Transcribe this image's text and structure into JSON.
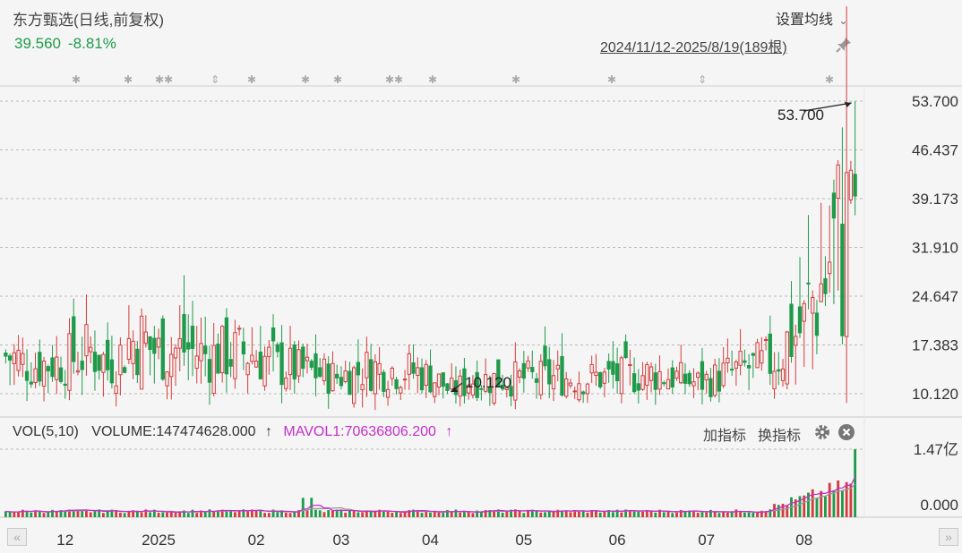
{
  "header": {
    "title": "东方甄选(日线,前复权)",
    "price": "39.560",
    "change": "-8.81%",
    "set_ma_label": "设置均线",
    "range_label": "2024/11/12-2025/8/19(189根)"
  },
  "volume_panel": {
    "vol_label": "VOL(5,10)",
    "volume_text": "VOLUME:147474628.000",
    "volume_arrow": "↑",
    "mavol_text": "MAVOL1:70636806.200",
    "mavol_arrow": "↑",
    "add_indicator": "加指标",
    "swap_indicator": "换指标"
  },
  "icons": {
    "pin": "pin-icon",
    "settings": "gear-icon",
    "close": "close-icon",
    "scroll_left": "double-chevron-left-icon",
    "scroll_right": "double-chevron-right-icon"
  },
  "colors": {
    "up": "#d63b3b",
    "down": "#1e9b4a",
    "ma5": "#c42fc9",
    "ma10": "#999999",
    "grid": "#bbbbbb"
  },
  "chart_data": [
    {
      "type": "candlestick",
      "title": "东方甄选(日线,前复权)",
      "y_ticks": [
        "53.700",
        "46.437",
        "39.173",
        "31.910",
        "24.647",
        "17.383",
        "10.120"
      ],
      "ylim": [
        10.12,
        53.7
      ],
      "x_ticks": [
        "12",
        "2025",
        "02",
        "03",
        "04",
        "05",
        "06",
        "07",
        "08"
      ],
      "grid": "horizontal dashed",
      "annotations": [
        {
          "label": "53.700",
          "kind": "period high"
        },
        {
          "label": "10.120",
          "kind": "period low"
        }
      ],
      "event_markers": [
        "✱",
        "✱",
        "✱✱",
        "⇕",
        "✱",
        "✱",
        "✱",
        "✱✱",
        "✱",
        "✱",
        "✱",
        "⇕",
        "✱"
      ],
      "close_waypoints": [
        {
          "date": "2024-11-12",
          "close": 15.8
        },
        {
          "date": "2024-11-20",
          "close": 14.4
        },
        {
          "date": "2024-12-01",
          "close": 14.9
        },
        {
          "date": "2024-12-10",
          "close": 16.5
        },
        {
          "date": "2024-12-16",
          "close": 14.0
        },
        {
          "date": "2024-12-22",
          "close": 17.8
        },
        {
          "date": "2024-12-26",
          "close": 18.2
        },
        {
          "date": "2025-01-01",
          "close": 16.3
        },
        {
          "date": "2025-01-10",
          "close": 16.8
        },
        {
          "date": "2025-01-18",
          "close": 15.8
        },
        {
          "date": "2025-02-01",
          "close": 16.3
        },
        {
          "date": "2025-02-10",
          "close": 14.2
        },
        {
          "date": "2025-03-01",
          "close": 12.6
        },
        {
          "date": "2025-03-12",
          "close": 14.0
        },
        {
          "date": "2025-03-25",
          "close": 13.5
        },
        {
          "date": "2025-04-01",
          "close": 12.7
        },
        {
          "date": "2025-04-07",
          "close": 10.3
        },
        {
          "date": "2025-04-14",
          "close": 12.2
        },
        {
          "date": "2025-05-01",
          "close": 12.4
        },
        {
          "date": "2025-06-01",
          "close": 12.6
        },
        {
          "date": "2025-06-15",
          "close": 13.2
        },
        {
          "date": "2025-06-28",
          "close": 11.6
        },
        {
          "date": "2025-07-10",
          "close": 13.5
        },
        {
          "date": "2025-07-22",
          "close": 14.8
        },
        {
          "date": "2025-07-31",
          "close": 19.5
        },
        {
          "date": "2025-08-05",
          "close": 24.0
        },
        {
          "date": "2025-08-11",
          "close": 30.5
        },
        {
          "date": "2025-08-15",
          "close": 33.5
        },
        {
          "date": "2025-08-18",
          "close": 43.4
        },
        {
          "date": "2025-08-19",
          "close": 39.56
        }
      ],
      "last_bar": {
        "date": "2025-08-19",
        "high": 53.7,
        "close": 39.56,
        "change": "-8.81%"
      }
    },
    {
      "type": "bar",
      "title": "VOL(5,10)",
      "y_ticks": [
        "1.47亿",
        "0.000"
      ],
      "ylim": [
        0,
        147474628
      ],
      "series": [
        {
          "name": "VOLUME",
          "last_value": 147474628.0
        },
        {
          "name": "MAVOL1",
          "last_value": 70636806.2
        }
      ]
    }
  ]
}
